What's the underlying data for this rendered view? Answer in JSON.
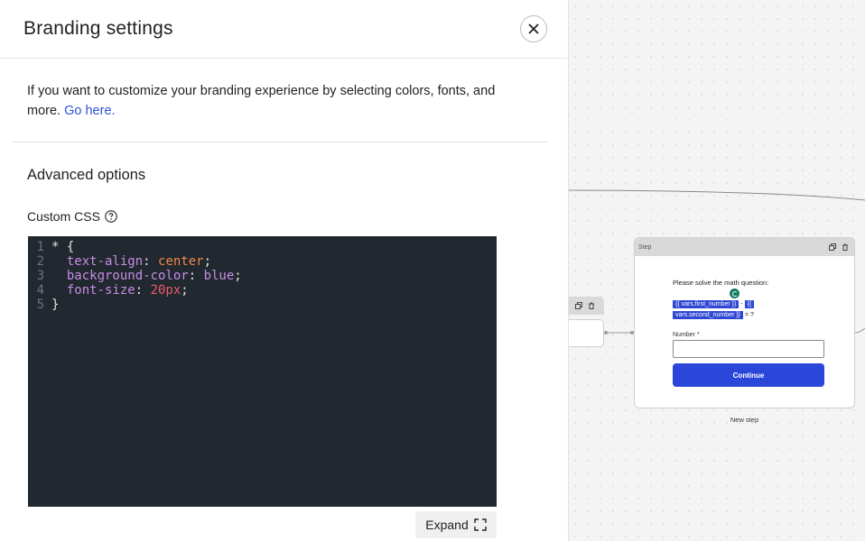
{
  "panel": {
    "title": "Branding settings",
    "intro_text": "If you want to customize your branding experience by selecting colors, fonts, and more.",
    "intro_link": "Go here.",
    "advanced_title": "Advanced options",
    "custom_css_label": "Custom CSS",
    "expand_label": "Expand"
  },
  "editor": {
    "lines": [
      {
        "num": "1",
        "parts": [
          "* {"
        ]
      },
      {
        "num": "2",
        "prop": "text-align",
        "value": "center",
        "kind": "val"
      },
      {
        "num": "3",
        "prop": "background-color",
        "value": "blue",
        "kind": "prop"
      },
      {
        "num": "4",
        "prop": "font-size",
        "value": "20px",
        "kind": "num"
      },
      {
        "num": "5",
        "parts": [
          "}"
        ]
      }
    ]
  },
  "canvas": {
    "step_label": "Step",
    "question": "Please solve the math question:",
    "var_first": "{{ vars.first_number }}",
    "operator": "-",
    "var_second_open": "{{",
    "var_second": "vars.second_number }}",
    "equals": "= ?",
    "field_label": "Number *",
    "continue_label": "Continue",
    "caption": "New step"
  },
  "colors": {
    "accent": "#2b47d9",
    "editor_bg": "#21282f",
    "link": "#2c52d6"
  }
}
